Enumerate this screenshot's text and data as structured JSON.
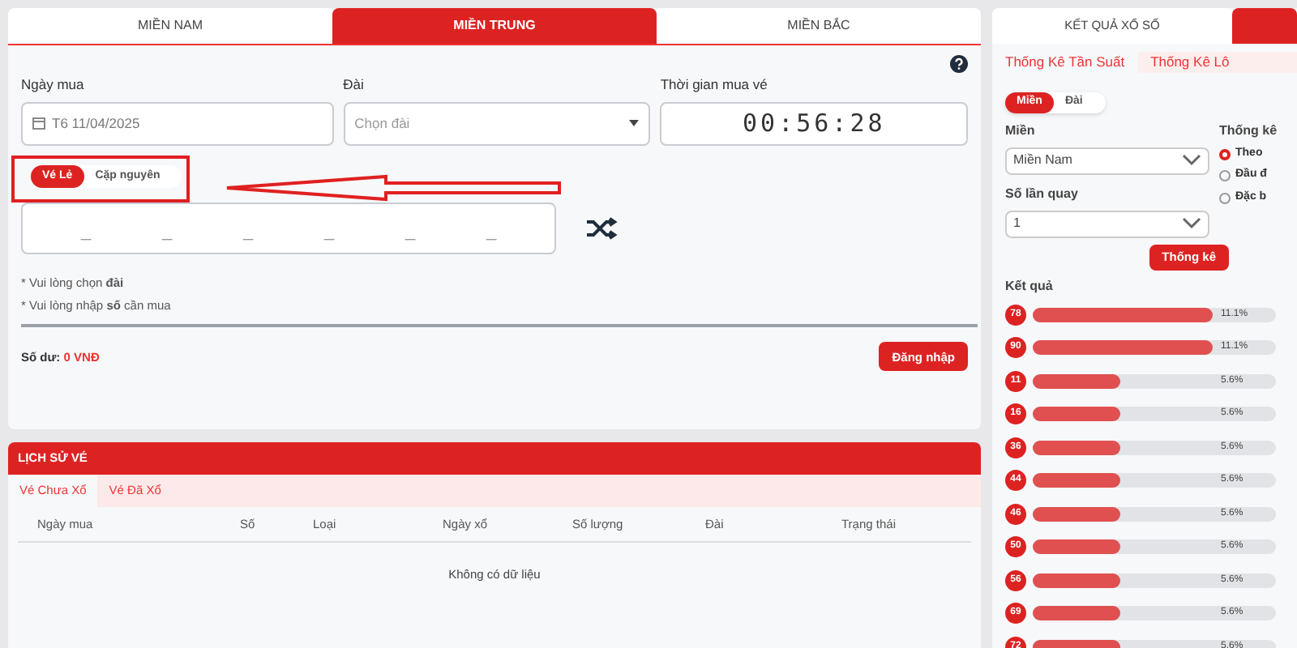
{
  "region_tabs": [
    {
      "label": "MIỀN NAM",
      "selected": false
    },
    {
      "label": "MIỀN TRUNG",
      "selected": true
    },
    {
      "label": "MIỀN BẮC",
      "selected": false
    }
  ],
  "form": {
    "date_label": "Ngày mua",
    "date_value": "T6 11/04/2025",
    "station_label": "Đài",
    "station_placeholder": "Chọn đài",
    "time_label": "Thời gian mua vé",
    "time_value": "00:56:28"
  },
  "ticket_types": [
    {
      "label": "Vé Lẻ",
      "selected": true
    },
    {
      "label": "Cặp nguyên",
      "selected": false
    }
  ],
  "digit_slots": [
    "_",
    "_",
    "_",
    "_",
    "_",
    "_"
  ],
  "notes": [
    "* Vui lòng chọn **đài**",
    "* Vui lòng nhập **số** cần mua"
  ],
  "balance": {
    "label": "Số dư:",
    "value": "0 VNĐ"
  },
  "login_button": "Đăng nhập",
  "history": {
    "title": "LỊCH SỬ VÉ",
    "tabs": [
      {
        "label": "Vé Chưa Xổ",
        "selected": true
      },
      {
        "label": "Vé Đã Xổ",
        "selected": false
      }
    ],
    "columns": [
      "Ngày mua",
      "Số",
      "Loại",
      "Ngày xổ",
      "Số lượng",
      "Đài",
      "Trạng thái"
    ],
    "empty": "Không có dữ liệu"
  },
  "results_panel": {
    "tabs": [
      {
        "label": "KẾT QUẢ XỔ SỐ",
        "selected": false
      },
      {
        "selected": true
      }
    ],
    "sub_tabs": [
      {
        "label": "Thống Kê Tần Suất",
        "selected": true
      },
      {
        "label": "Thống Kê Lô",
        "selected": false
      }
    ],
    "mode_toggle": [
      {
        "label": "Miền",
        "selected": true
      },
      {
        "label": "Đài",
        "selected": false
      }
    ],
    "region_label": "Miền",
    "region_value": "Miền Nam",
    "spins_label": "Số lần quay",
    "spins_value": "1",
    "stat_label": "Thống kê",
    "stat_options": [
      {
        "label": "Theo",
        "selected": true
      },
      {
        "label": "Đầu đ",
        "selected": false
      },
      {
        "label": "Đặc b",
        "selected": false
      }
    ],
    "submit": "Thống kê",
    "results_label": "Kết quả",
    "results": [
      {
        "number": "78",
        "level": 0.74,
        "reading": "11.1%"
      },
      {
        "number": "90",
        "level": 0.74,
        "reading": "11.1%"
      },
      {
        "number": "11",
        "level": 0.36,
        "reading": "5.6%"
      },
      {
        "number": "16",
        "level": 0.36,
        "reading": "5.6%"
      },
      {
        "number": "36",
        "level": 0.36,
        "reading": "5.6%"
      },
      {
        "number": "44",
        "level": 0.36,
        "reading": "5.6%"
      },
      {
        "number": "46",
        "level": 0.36,
        "reading": "5.6%"
      },
      {
        "number": "50",
        "level": 0.36,
        "reading": "5.6%"
      },
      {
        "number": "56",
        "level": 0.36,
        "reading": "5.6%"
      },
      {
        "number": "69",
        "level": 0.36,
        "reading": "5.6%"
      },
      {
        "number": "72",
        "level": 0.36,
        "reading": "5.6%"
      }
    ]
  }
}
